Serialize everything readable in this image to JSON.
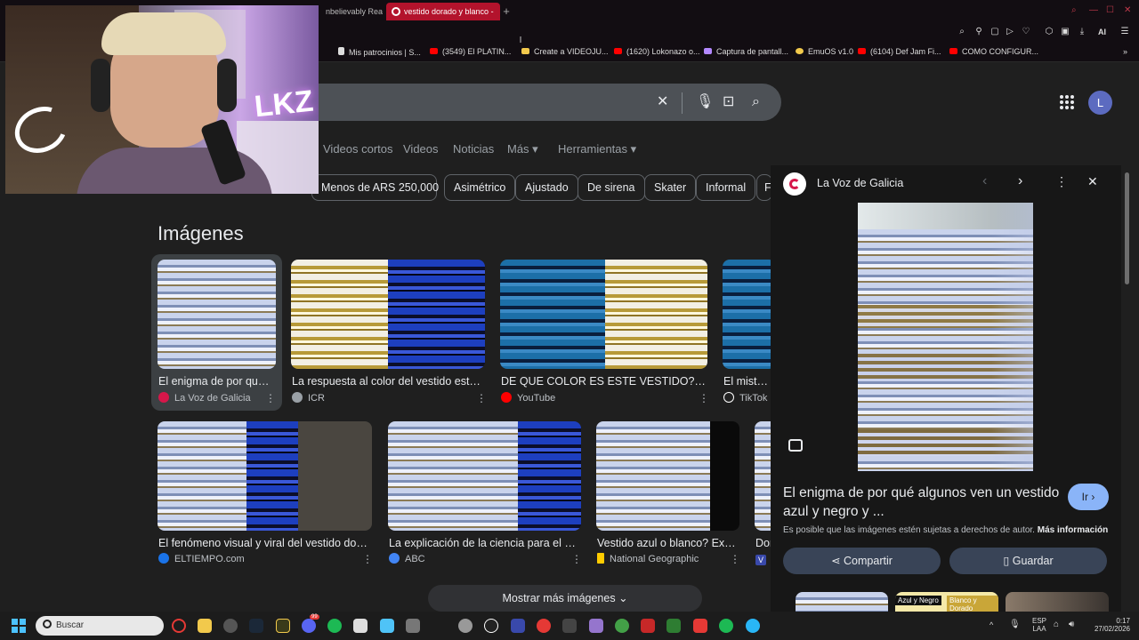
{
  "browser": {
    "tabs": [
      {
        "label": "nbelievably Real"
      },
      {
        "label": "vestido dorado y blanco -",
        "active": true
      }
    ],
    "new_tab_symbol": "+",
    "toolbar_icons": [
      "zoom-icon",
      "pin-icon",
      "snapshot-icon",
      "play-icon",
      "heart-icon",
      "extensions-icon",
      "wallet-icon",
      "download-icon"
    ],
    "ai_label": "AI",
    "bookmarks": [
      {
        "label": "Mis patrocinios | S...",
        "color": "#dddddd"
      },
      {
        "label": "(3549) El PLATIN...",
        "color": "#ff0000"
      },
      {
        "label": "Create a VIDEOJU...",
        "color": "#f2c94c"
      },
      {
        "label": "(1620) Lokonazo o...",
        "color": "#ff0000"
      },
      {
        "label": "Captura de pantall...",
        "color": "#b388ff"
      },
      {
        "label": "EmuOS v1.0",
        "color": "#f2c94c"
      },
      {
        "label": "(6104) Def Jam Fi...",
        "color": "#ff0000"
      },
      {
        "label": "COMO CONFIGUR...",
        "color": "#ff0000"
      }
    ]
  },
  "google": {
    "search": {
      "query": ""
    },
    "avatar_letter": "L",
    "nav_tabs": [
      "Videos cortos",
      "Videos",
      "Noticias",
      "Más ▾",
      "Herramientas ▾"
    ],
    "chips": [
      "Menos de ARS 250,000",
      "Asimétrico",
      "Ajustado",
      "De sirena",
      "Skater",
      "Informal",
      "F"
    ],
    "images_title": "Imágenes",
    "results_row1": [
      {
        "caption": "El enigma de por qué ...",
        "source": "La Voz de Galicia",
        "source_color": "#d6174a"
      },
      {
        "caption": "La respuesta al color del vestido está d...",
        "source": "ICR",
        "source_color": "#9aa0a6"
      },
      {
        "caption": "DE QUE COLOR ES ESTE VESTIDO? - ...",
        "source": "YouTube",
        "source_color": "#ff0000"
      },
      {
        "caption": "El misterio",
        "source": "TikTok",
        "source_color": "#222222"
      }
    ],
    "results_row2": [
      {
        "caption": "El fenómeno visual y viral del vestido dorad...",
        "source": "ELTIEMPO.com",
        "source_color": "#1a73e8"
      },
      {
        "caption": "La explicación de la ciencia para el ves...",
        "source": "ABC",
        "source_color": "#4285f4"
      },
      {
        "caption": "Vestido azul o blanco? Expli...",
        "source": "National Geographic",
        "source_color": "#ffcc00"
      },
      {
        "caption": "Dor",
        "source": "V",
        "source_color": "#3949ab"
      }
    ],
    "more_images": "Mostrar más imágenes",
    "panel": {
      "source": "La Voz de Galicia",
      "title": "El enigma de por qué algunos ven un vestido azul y negro y ...",
      "visit_button": "Ir ›",
      "copyright_text": "Es posible que las imágenes estén sujetas a derechos de autor.",
      "copyright_link": "Más información",
      "share_button": "Compartir",
      "save_button": "Guardar",
      "related_labels": [
        "Azul y Negro",
        "Blanco y Dorado"
      ]
    }
  },
  "webcam": {
    "sign_text": "LKZ"
  },
  "taskbar": {
    "search_placeholder": "Buscar",
    "language": "ESP",
    "layout": "LAA",
    "time": "0:17",
    "date": "27/02/2026",
    "badge_count": "99"
  }
}
